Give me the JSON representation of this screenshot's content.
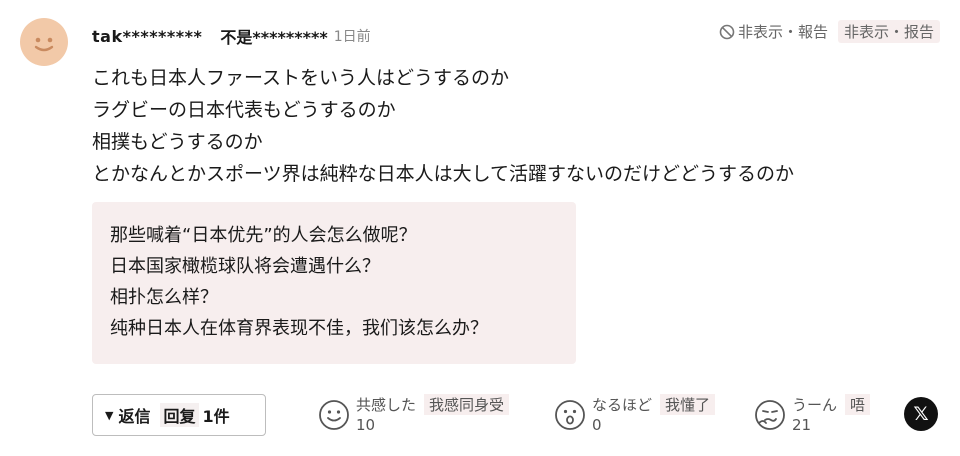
{
  "comment": {
    "username": "tak*********",
    "username_tr": "不是*********",
    "time": "1日前"
  },
  "actions": {
    "hide_report": "非表示・報告",
    "hide_report_tr": "非表示・报告"
  },
  "body_lines": [
    "これも日本人ファーストをいう人はどうするのか",
    "ラグビーの日本代表もどうするのか",
    "相撲もどうするのか",
    "とかなんとかスポーツ界は純粋な日本人は大して活躍すないのだけどどうするのか"
  ],
  "translation_lines": [
    "那些喊着“日本优先”的人会怎么做呢？",
    "日本国家橄榄球队将会遭遇什么？",
    "相扑怎么样？",
    "纯种日本人在体育界表现不佳，我们该怎么办？"
  ],
  "reply": {
    "label": "返信",
    "tr": "回复",
    "count": "1件"
  },
  "reactions": [
    {
      "icon": "smile-icon",
      "label": "共感した",
      "tr": "我感同身受",
      "count": "10"
    },
    {
      "icon": "surprised-icon",
      "label": "なるほど",
      "tr": "我懂了",
      "count": "0"
    },
    {
      "icon": "thinking-icon",
      "label": "うーん",
      "tr": "唔",
      "count": "21"
    }
  ],
  "share": {
    "icon": "x-logo-icon",
    "label": "𝕏"
  },
  "colors": {
    "avatar_bg": "#f2c9a8",
    "translation_bg": "#f7eeee",
    "share_bg": "#111111"
  }
}
